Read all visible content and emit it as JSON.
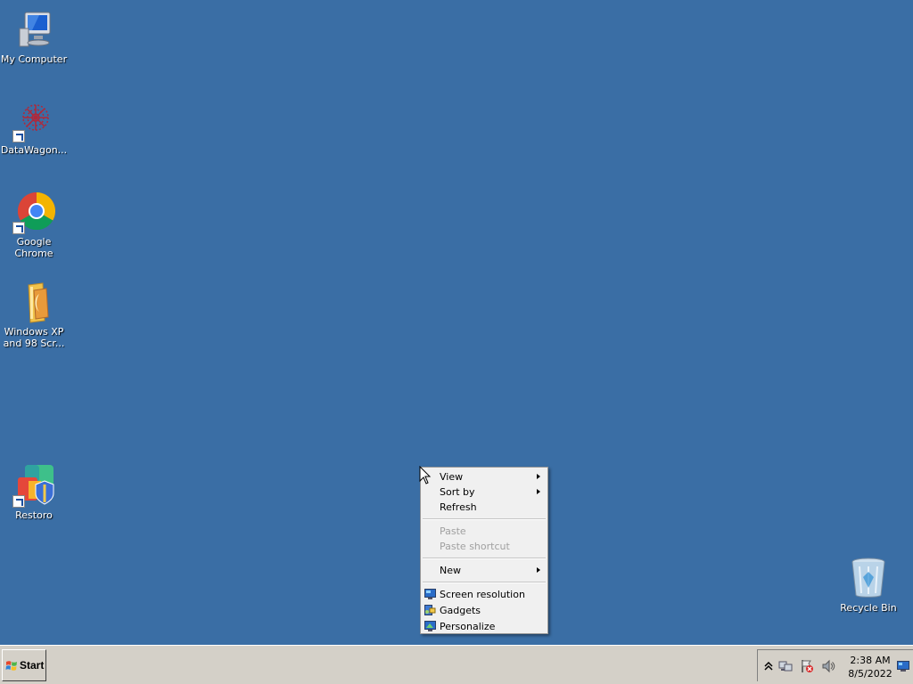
{
  "desktop": {
    "icons": [
      {
        "label": "My Computer",
        "icon": "computer-icon"
      },
      {
        "label": "DataWagon...",
        "icon": "datawagon-icon"
      },
      {
        "label": "Google Chrome",
        "icon": "chrome-icon"
      },
      {
        "label": "Windows XP and 98 Scr...",
        "icon": "folder-icon"
      },
      {
        "label": "Restoro",
        "icon": "restoro-icon"
      },
      {
        "label": "Recycle Bin",
        "icon": "recycle-bin-icon"
      }
    ],
    "background_color": "#3a6ea5"
  },
  "context_menu": {
    "items": [
      {
        "label": "View",
        "submenu": true
      },
      {
        "label": "Sort by",
        "submenu": true
      },
      {
        "label": "Refresh"
      },
      {
        "label": "Paste",
        "disabled": true
      },
      {
        "label": "Paste shortcut",
        "disabled": true
      },
      {
        "label": "New",
        "submenu": true
      },
      {
        "label": "Screen resolution",
        "icon": "monitor-icon"
      },
      {
        "label": "Gadgets",
        "icon": "gadgets-icon"
      },
      {
        "label": "Personalize",
        "icon": "personalize-icon"
      }
    ]
  },
  "taskbar": {
    "start_label": "Start",
    "clock_time": "2:38 AM",
    "clock_date": "8/5/2022"
  }
}
